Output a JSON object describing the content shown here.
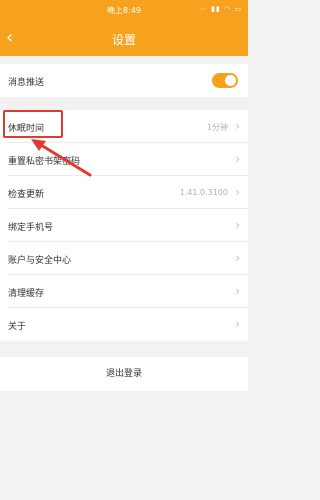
{
  "status_bar": {
    "time": "晚上8:49",
    "system_icons": "⋯ ▮▮ ◠ ▭"
  },
  "header": {
    "back_icon": "‹",
    "title": "设置"
  },
  "settings": {
    "push": {
      "label": "消息推送",
      "toggle_on": true
    },
    "sleep_time": {
      "label": "休眠时间",
      "value": "1分钟"
    },
    "reset_password": {
      "label": "重置私密书架密码"
    },
    "check_update": {
      "label": "检查更新",
      "value": "1.41.0.3100"
    },
    "bind_phone": {
      "label": "绑定手机号"
    },
    "account_security": {
      "label": "账户与安全中心"
    },
    "clear_cache": {
      "label": "清理缓存"
    },
    "about": {
      "label": "关于"
    }
  },
  "chevron": "›",
  "logout": {
    "label": "退出登录"
  },
  "colors": {
    "accent": "#f6a21e",
    "annotation": "#e23a2e",
    "background": "#f2f2f2"
  }
}
